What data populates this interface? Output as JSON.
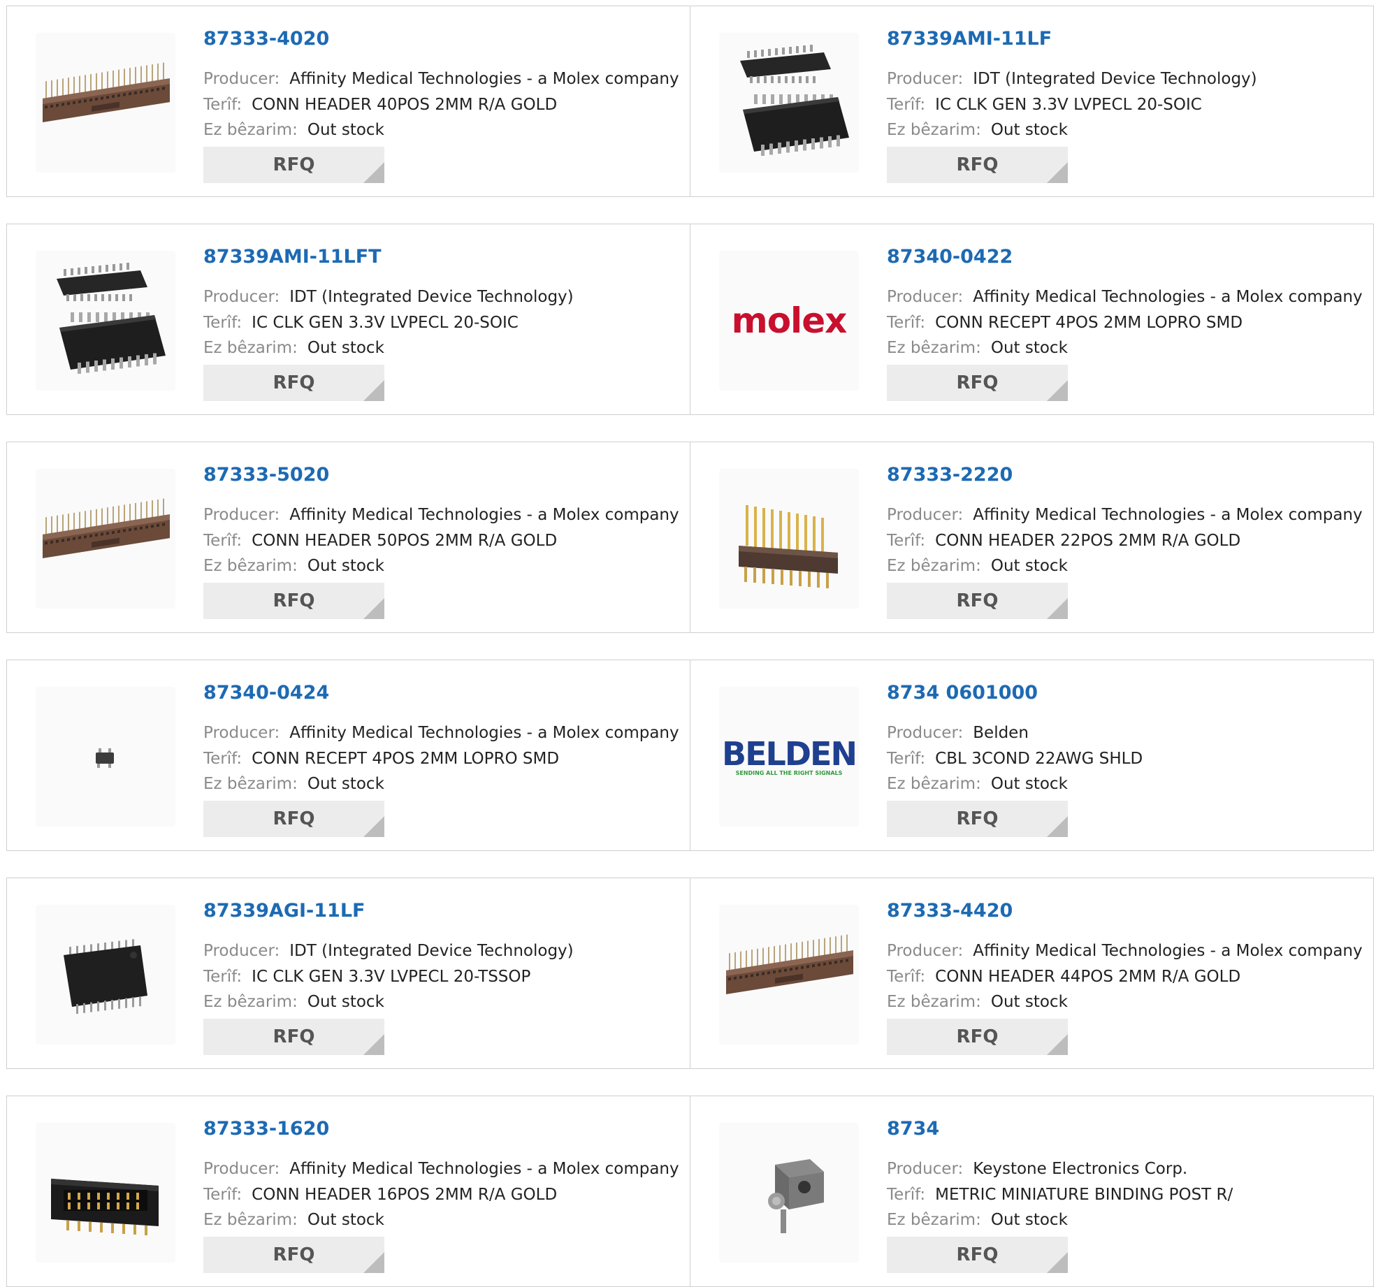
{
  "labels": {
    "producer": "Producer:",
    "description": "Terîf:",
    "stock": "Ez bêzarim:"
  },
  "products": [
    {
      "part": "87333-4020",
      "producer": "Affinity Medical Technologies - a Molex company",
      "description": "CONN HEADER 40POS 2MM R/A GOLD",
      "stock": "Out stock",
      "rfq": "RFQ",
      "image": "header-connector-long"
    },
    {
      "part": "87339AMI-11LF",
      "producer": "IDT (Integrated Device Technology)",
      "description": "IC CLK GEN 3.3V LVPECL 20-SOIC",
      "stock": "Out stock",
      "rfq": "RFQ",
      "image": "soic-chip"
    },
    {
      "part": "87339AMI-11LFT",
      "producer": "IDT (Integrated Device Technology)",
      "description": "IC CLK GEN 3.3V LVPECL 20-SOIC",
      "stock": "Out stock",
      "rfq": "RFQ",
      "image": "soic-chip"
    },
    {
      "part": "87340-0422",
      "producer": "Affinity Medical Technologies - a Molex company",
      "description": "CONN RECEPT 4POS 2MM LOPRO SMD",
      "stock": "Out stock",
      "rfq": "RFQ",
      "image": "molex-logo",
      "logo_text": "molex",
      "logo_color": "#c8102e"
    },
    {
      "part": "87333-5020",
      "producer": "Affinity Medical Technologies - a Molex company",
      "description": "CONN HEADER 50POS 2MM R/A GOLD",
      "stock": "Out stock",
      "rfq": "RFQ",
      "image": "header-connector-long"
    },
    {
      "part": "87333-2220",
      "producer": "Affinity Medical Technologies - a Molex company",
      "description": "CONN HEADER 22POS 2MM R/A GOLD",
      "stock": "Out stock",
      "rfq": "RFQ",
      "image": "header-connector-gold"
    },
    {
      "part": "87340-0424",
      "producer": "Affinity Medical Technologies - a Molex company",
      "description": "CONN RECEPT 4POS 2MM LOPRO SMD",
      "stock": "Out stock",
      "rfq": "RFQ",
      "image": "small-smd-connector"
    },
    {
      "part": "8734 0601000",
      "producer": "Belden",
      "description": "CBL 3COND 22AWG SHLD",
      "stock": "Out stock",
      "rfq": "RFQ",
      "image": "belden-logo",
      "logo_text": "BELDEN",
      "logo_tagline": "SENDING ALL THE RIGHT SIGNALS",
      "logo_color": "#1f3f8f",
      "logo_tagline_color": "#2e9a3a"
    },
    {
      "part": "87339AGI-11LF",
      "producer": "IDT (Integrated Device Technology)",
      "description": "IC CLK GEN 3.3V LVPECL 20-TSSOP",
      "stock": "Out stock",
      "rfq": "RFQ",
      "image": "tssop-chip"
    },
    {
      "part": "87333-4420",
      "producer": "Affinity Medical Technologies - a Molex company",
      "description": "CONN HEADER 44POS 2MM R/A GOLD",
      "stock": "Out stock",
      "rfq": "RFQ",
      "image": "header-connector-long"
    },
    {
      "part": "87333-1620",
      "producer": "Affinity Medical Technologies - a Molex company",
      "description": "CONN HEADER 16POS 2MM R/A GOLD",
      "stock": "Out stock",
      "rfq": "RFQ",
      "image": "box-header-connector"
    },
    {
      "part": "8734",
      "producer": "Keystone Electronics Corp.",
      "description": "METRIC MINIATURE BINDING POST R/",
      "stock": "Out stock",
      "rfq": "RFQ",
      "image": "binding-post"
    }
  ]
}
